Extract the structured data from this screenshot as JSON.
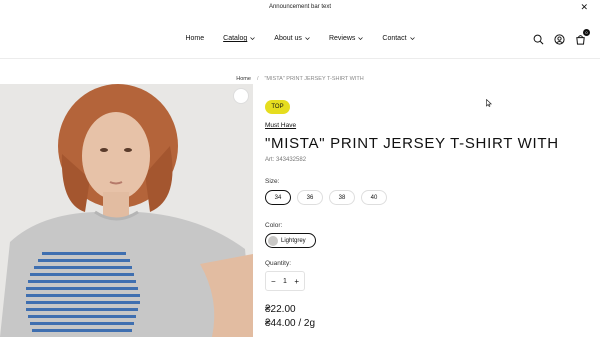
{
  "announcement": {
    "text": "Announcement bar text",
    "close_glyph": "✕"
  },
  "nav": {
    "items": [
      {
        "label": "Home",
        "has_dropdown": false
      },
      {
        "label": "Catalog",
        "has_dropdown": true
      },
      {
        "label": "About us",
        "has_dropdown": true
      },
      {
        "label": "Reviews",
        "has_dropdown": true
      },
      {
        "label": "Contact",
        "has_dropdown": true
      }
    ],
    "icons": [
      "search-icon",
      "account-icon",
      "cart-icon"
    ],
    "cart_count": "0"
  },
  "breadcrumb": {
    "home": "Home",
    "separator": "/",
    "current": "\"MISTA\" PRINT JERSEY T-SHIRT WITH"
  },
  "product": {
    "badge": "TOP",
    "collection": "Must Have",
    "title": "\"MISTA\" PRINT JERSEY T-SHIRT WITH",
    "article": "Art: 343432582",
    "size_label": "Size:",
    "sizes": [
      "34",
      "36",
      "38",
      "40"
    ],
    "selected_size": "34",
    "color_label": "Color:",
    "color": "Lightgrey",
    "color_hex": "#c9c8c6",
    "quantity_label": "Quantity:",
    "quantity": "1",
    "minus": "−",
    "plus": "+",
    "price": "₴22.00",
    "price_secondary": "₴44.00 / 2g"
  },
  "colors": {
    "badge": "#e6dd1f",
    "text": "#111111"
  }
}
